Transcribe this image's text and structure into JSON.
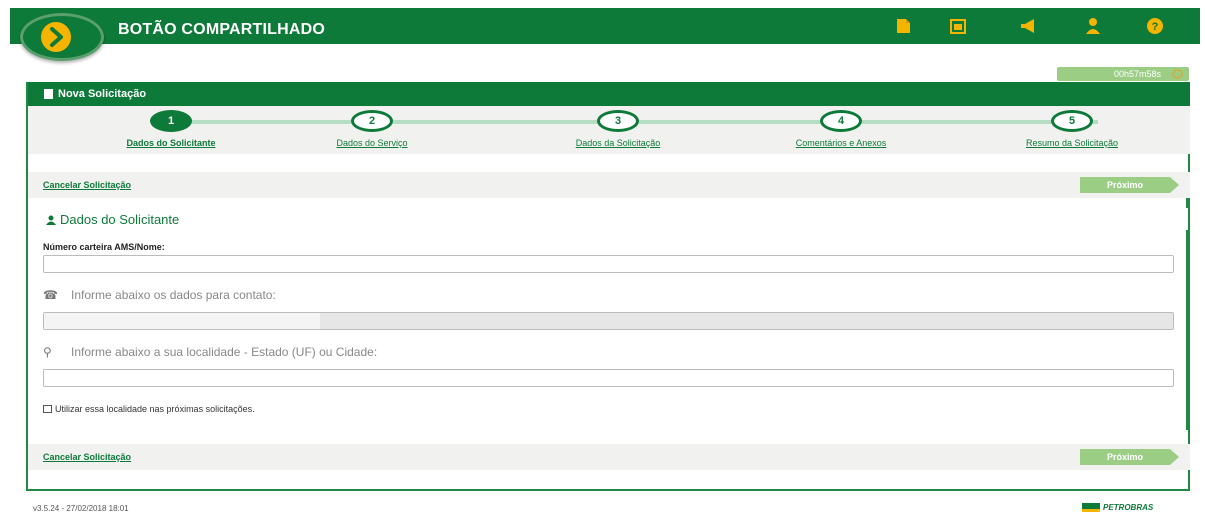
{
  "header": {
    "title": "BOTÃO COMPARTILHADO",
    "icons": [
      "document-icon",
      "calendar-icon",
      "megaphone-icon",
      "user-icon",
      "help-icon"
    ]
  },
  "timer": "00h57m58s",
  "panel": {
    "title": "Nova Solicitação",
    "steps": [
      {
        "number": "1",
        "label": "Dados do Solicitante"
      },
      {
        "number": "2",
        "label": "Dados do Serviço"
      },
      {
        "number": "3",
        "label": "Dados da Solicitação"
      },
      {
        "number": "4",
        "label": "Comentários e Anexos"
      },
      {
        "number": "5",
        "label": "Resumo da Solicitação"
      }
    ],
    "active_step": 1
  },
  "actions": {
    "cancel_label": "Cancelar Solicitação",
    "next_label": "Próximo"
  },
  "form": {
    "section_title": "Dados do Solicitante",
    "field_label": "Número carteira AMS/Nome:",
    "field_value": "",
    "contact_info": "Informe abaixo os dados para contato:",
    "contact_value": "",
    "location_info": "Informe abaixo a sua localidade - Estado (UF) ou Cidade:",
    "location_value": "",
    "checkbox_label": "Utilizar essa localidade nas próximas solicitações."
  },
  "footer": {
    "version": "v3.5.24 - 27/02/2018 18:01",
    "brand": "PETROBRAS"
  },
  "colors": {
    "primary": "#0e7a3a",
    "accent": "#f4b400",
    "button_disabled": "#9bcd85"
  }
}
